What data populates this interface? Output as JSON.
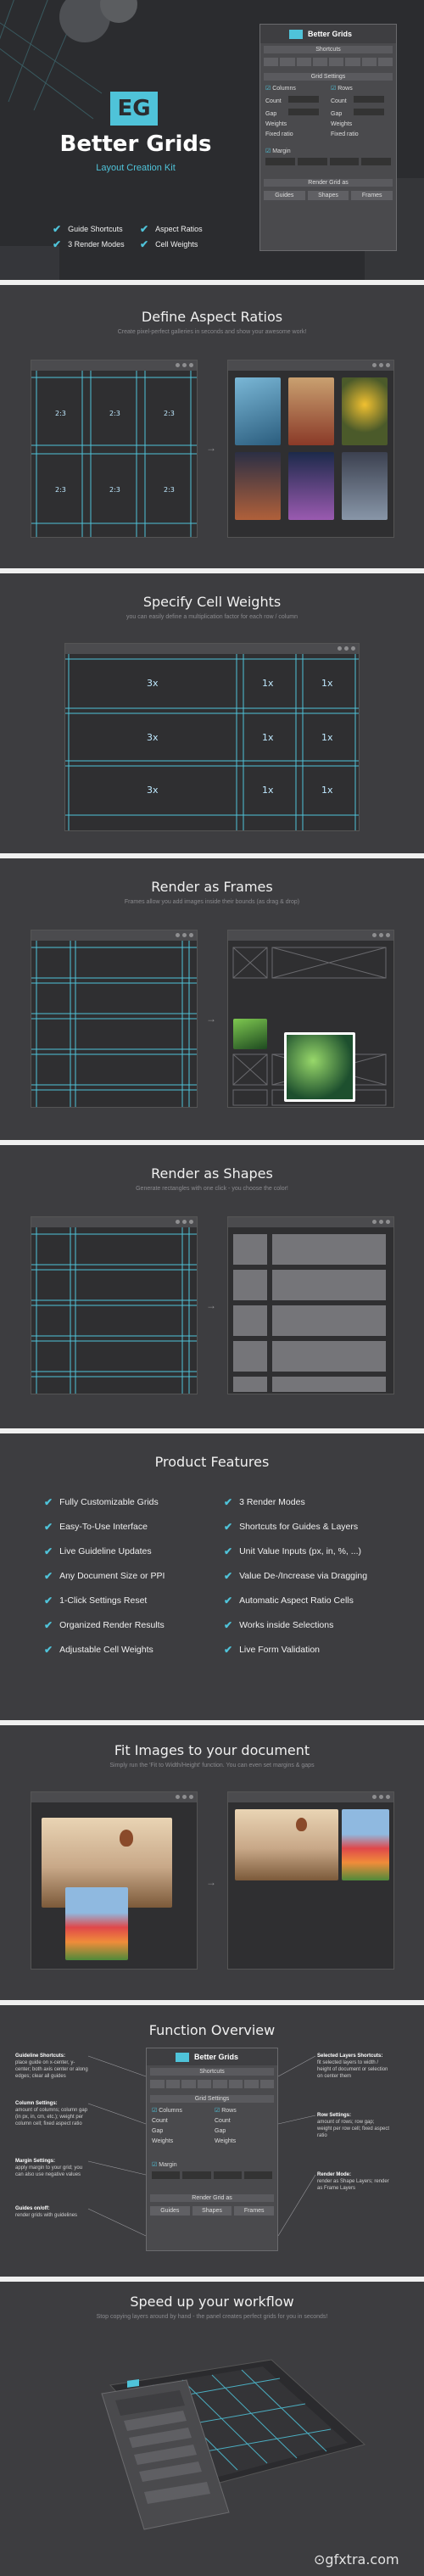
{
  "hero": {
    "logo_letters": "EG",
    "title": "Better Grids",
    "subtitle": "Layout Creation Kit",
    "features": [
      "Guide Shortcuts",
      "Aspect Ratios",
      "3 Render Modes",
      "Cell Weights"
    ]
  },
  "hero_panel": {
    "title": "Better Grids",
    "shortcuts_label": "Shortcuts",
    "grid_settings_label": "Grid Settings",
    "columns_label": "Columns",
    "rows_label": "Rows",
    "count_label": "Count",
    "gap_label": "Gap",
    "weights_label": "Weights",
    "fixed_ratio_label": "Fixed ratio",
    "margin_label": "Margin",
    "render_label": "Render Grid as",
    "render_modes": [
      "Guides",
      "Shapes",
      "Frames"
    ]
  },
  "aspect": {
    "title": "Define Aspect Ratios",
    "subtitle": "Create pixel-perfect galleries in seconds and show your awesome work!",
    "cell_label": "2:3"
  },
  "weights": {
    "title": "Specify Cell Weights",
    "subtitle": "you can easily define a multiplication factor for each row / column",
    "labels": [
      "3x",
      "1x",
      "1x"
    ]
  },
  "frames": {
    "title": "Render as Frames",
    "subtitle": "Frames allow you add images inside their bounds (as drag & drop)"
  },
  "shapes": {
    "title": "Render as Shapes",
    "subtitle": "Generate rectangles with one click - you choose the color!"
  },
  "product_features": {
    "title": "Product Features",
    "left": [
      "Fully Customizable Grids",
      "Easy-To-Use Interface",
      "Live Guideline Updates",
      "Any Document Size or PPI",
      "1-Click Settings Reset",
      "Organized Render Results",
      "Adjustable Cell Weights"
    ],
    "right": [
      "3 Render Modes",
      "Shortcuts for Guides & Layers",
      "Unit Value Inputs (px, in, %, ...)",
      "Value De-/Increase via Dragging",
      "Automatic Aspect Ratio Cells",
      "Works inside Selections",
      "Live Form Validation"
    ]
  },
  "fit": {
    "title": "Fit Images to your document",
    "subtitle": "Simply run the 'Fit to Width/Height' function. You can even set margins & gaps"
  },
  "function_overview": {
    "title": "Function Overview",
    "left_notes": [
      {
        "head": "Guideline Shortcuts:",
        "body": "place guide on x-center, y-center; both axis center or along edges; clear all guides"
      },
      {
        "head": "Column Settings:",
        "body": "amount of columns; column gap (in px, in, cm, etc.); weight per column cell; fixed aspect ratio"
      },
      {
        "head": "Margin Settings:",
        "body": "apply margin to your grid; you can also use negative values"
      },
      {
        "head": "Guides on/off:",
        "body": "render grids with guidelines"
      }
    ],
    "right_notes": [
      {
        "head": "Selected Layers Shortcuts:",
        "body": "fit selected layers to width / height of document or selection on center them"
      },
      {
        "head": "Row Settings:",
        "body": "amount of rows; row gap; weight per row cell; fixed aspect ratio"
      },
      {
        "head": "Render Mode:",
        "body": "render as Shape Layers; render as Frame Layers"
      }
    ]
  },
  "workflow": {
    "title": "Speed up your workflow",
    "subtitle": "Stop copying layers around by hand - the panel creates perfect grids for you in seconds!"
  },
  "colors": {
    "accent": "#4fc3d9",
    "background": "#3d3d40",
    "separator": "#f0f0f0"
  }
}
